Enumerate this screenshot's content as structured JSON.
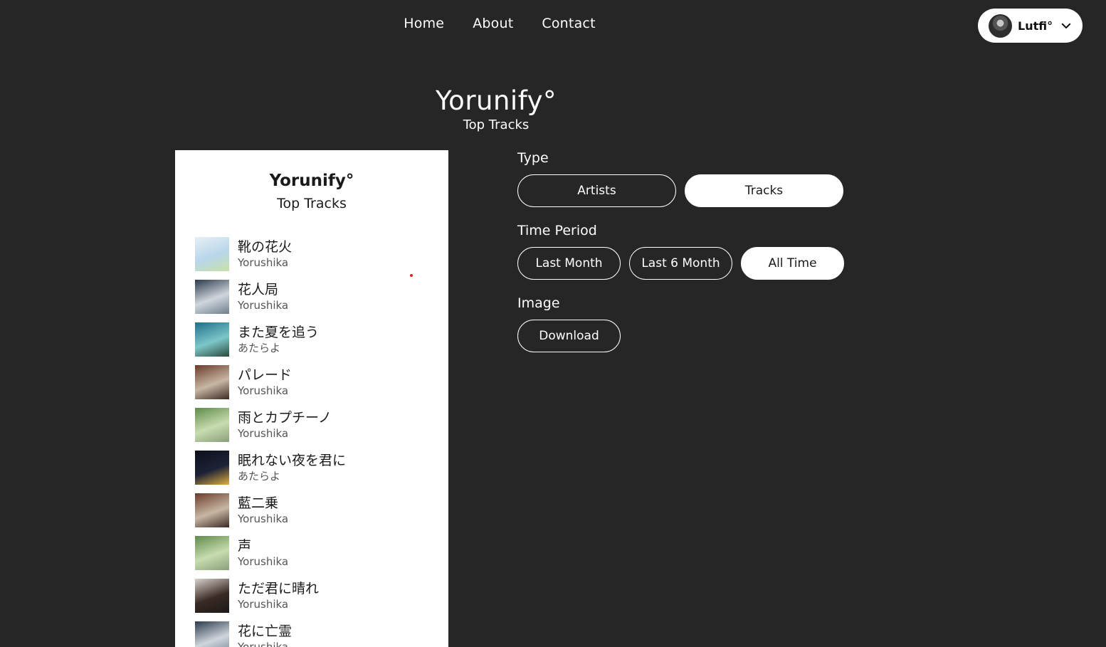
{
  "nav": {
    "links": [
      "Home",
      "About",
      "Contact"
    ],
    "user": {
      "name": "Lutfi°"
    }
  },
  "hero": {
    "title": "Yorunify°",
    "subtitle": "Top Tracks"
  },
  "card": {
    "title": "Yorunify°",
    "subtitle": "Top Tracks",
    "tracks": [
      {
        "name": "靴の花火",
        "artist": "Yorushika",
        "art": [
          "#e6eff4",
          "#b8d6ea",
          "#c8e2a8"
        ]
      },
      {
        "name": "花人局",
        "artist": "Yorushika",
        "art": [
          "#2c3a4d",
          "#cfd6dc",
          "#6f7f8d"
        ]
      },
      {
        "name": "また夏を追う",
        "artist": "あたらよ",
        "art": [
          "#1f6f8b",
          "#7dc7c9",
          "#2a4a3c"
        ]
      },
      {
        "name": "パレード",
        "artist": "Yorushika",
        "art": [
          "#6b3a2a",
          "#c7b7a3",
          "#3a2a24"
        ]
      },
      {
        "name": "雨とカプチーノ",
        "artist": "Yorushika",
        "art": [
          "#5e8b4a",
          "#c8dcb0",
          "#8a9f7a"
        ]
      },
      {
        "name": "眠れない夜を君に",
        "artist": "あたらよ",
        "art": [
          "#0d0f1a",
          "#1d2236",
          "#e0b040"
        ]
      },
      {
        "name": "藍二乗",
        "artist": "Yorushika",
        "art": [
          "#6b3a2a",
          "#c7b7a3",
          "#3a2a24"
        ]
      },
      {
        "name": "声",
        "artist": "Yorushika",
        "art": [
          "#5e8b4a",
          "#c8dcb0",
          "#8a9f7a"
        ]
      },
      {
        "name": "ただ君に晴れ",
        "artist": "Yorushika",
        "art": [
          "#d8d2cc",
          "#3a2a24",
          "#1a1a1a"
        ]
      },
      {
        "name": "花に亡霊",
        "artist": "Yorushika",
        "art": [
          "#2c3a4d",
          "#cfd6dc",
          "#6f7f8d"
        ]
      }
    ]
  },
  "controls": {
    "type_label": "Type",
    "type_options": [
      "Artists",
      "Tracks"
    ],
    "type_selected": "Tracks",
    "period_label": "Time Period",
    "period_options": [
      "Last Month",
      "Last 6 Month",
      "All Time"
    ],
    "period_selected": "All Time",
    "image_label": "Image",
    "download_label": "Download"
  },
  "colors": {
    "background": "#262626",
    "card": "#ffffff",
    "text": "#ffffff"
  }
}
